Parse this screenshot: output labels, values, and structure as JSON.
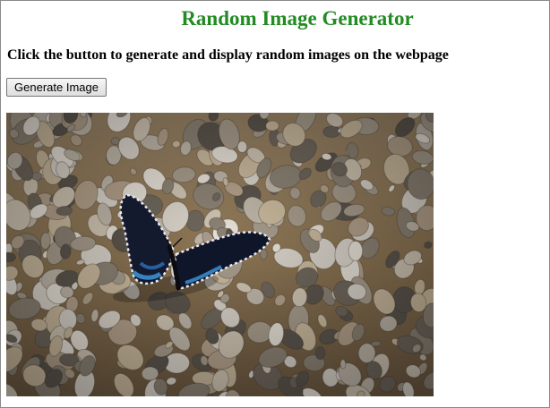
{
  "page": {
    "title": "Random Image Generator",
    "title_color": "#228b22",
    "instruction": "Click the button to generate and display random images on the webpage"
  },
  "controls": {
    "generate_label": "Generate Image"
  },
  "image": {
    "subject": "butterfly-on-gravel-photo"
  }
}
